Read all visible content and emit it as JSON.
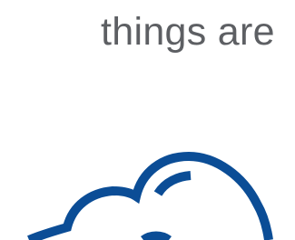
{
  "headline": {
    "text": "things are"
  },
  "illustration": {
    "icon": "cloud-icon",
    "stroke_color": "#0b4d96",
    "text_color": "#5d5f63",
    "background": "#ffffff"
  }
}
